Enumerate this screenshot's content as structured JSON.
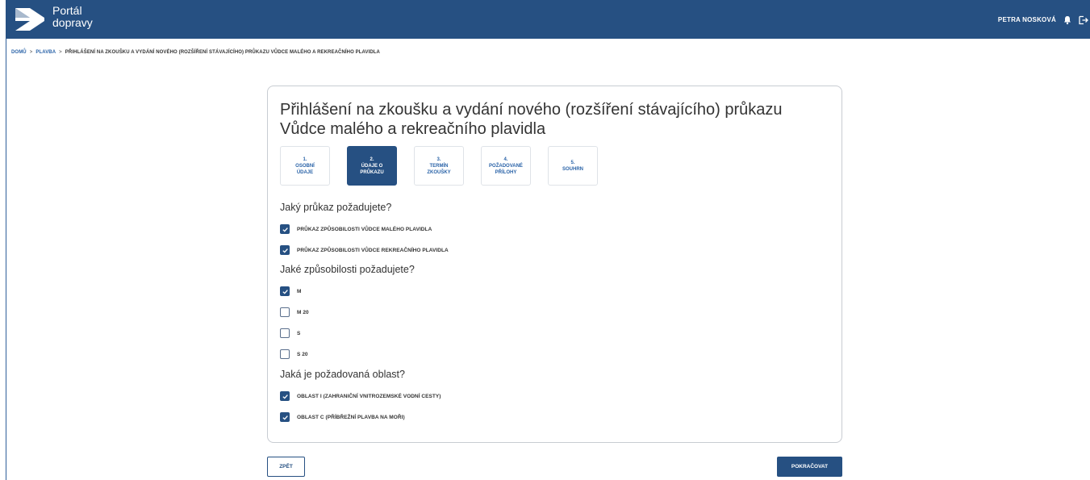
{
  "header": {
    "brand_line1": "Portál",
    "brand_line2": "dopravy",
    "user_name": "PETRA NOSKOVÁ",
    "bell_icon": "bell-icon",
    "logout_icon": "logout-icon"
  },
  "breadcrumb": {
    "items": [
      "DOMŮ",
      "PLAVBA",
      "PŘIHLÁŠENÍ NA ZKOUŠKU A VYDÁNÍ NOVÉHO (ROZŠÍŘENÍ STÁVAJÍCÍHO) PRŮKAZU VŮDCE MALÉHO A REKREAČNÍHO PLAVIDLA"
    ],
    "separator": ">"
  },
  "main": {
    "title": "Přihlášení na zkoušku a vydání nového (rozšíření stávajícího) průkazu Vůdce malého a rekreačního plavidla",
    "steps": [
      {
        "num": "1.",
        "label": "OSOBNÍ\nÚDAJE",
        "active": false
      },
      {
        "num": "2.",
        "label": "ÚDAJE O\nPRŮKAZU",
        "active": true
      },
      {
        "num": "3.",
        "label": "TERMÍN\nZKOUŠKY",
        "active": false
      },
      {
        "num": "4.",
        "label": "POŽADOVANÉ\nPŘÍLOHY",
        "active": false
      },
      {
        "num": "5.",
        "label": "SOUHRN",
        "active": false
      }
    ],
    "q1": {
      "question": "Jaký průkaz požadujete?",
      "options": [
        {
          "label": "PRŮKAZ ZPŮSOBILOSTI VŮDCE MALÉHO PLAVIDLA",
          "checked": true
        },
        {
          "label": "PRŮKAZ ZPŮSOBILOSTI VŮDCE REKREAČNÍHO PLAVIDLA",
          "checked": true
        }
      ]
    },
    "q2": {
      "question": "Jaké způsobilosti požadujete?",
      "options": [
        {
          "label": "M",
          "checked": true
        },
        {
          "label": "M 20",
          "checked": false
        },
        {
          "label": "S",
          "checked": false
        },
        {
          "label": "S 20",
          "checked": false
        }
      ]
    },
    "q3": {
      "question": "Jaká je požadovaná oblast?",
      "options": [
        {
          "label": "OBLAST I (ZAHRANIČNÍ VNITROZEMSKÉ VODNÍ CESTY)",
          "checked": true
        },
        {
          "label": "OBLAST C (PŘÍBŘEŽNÍ PLAVBA NA MOŘI)",
          "checked": true
        }
      ]
    }
  },
  "footer": {
    "back_label": "ZPĚT",
    "next_label": "POKRAČOVAT"
  },
  "colors": {
    "primary": "#265082",
    "link": "#2a63a8"
  }
}
